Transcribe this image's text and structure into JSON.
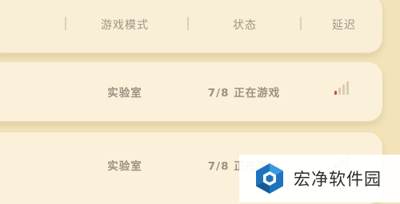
{
  "header": {
    "mode_label": "游戏模式",
    "status_label": "状态",
    "latency_label": "延迟"
  },
  "rows": [
    {
      "mode": "实验室",
      "status": "7/8 正在游戏",
      "signal_bars_active": 1,
      "signal_total_bars": 4,
      "signal_active_color": "#c8523e",
      "signal_inactive_color": "#d7cdb7"
    },
    {
      "mode": "实验室",
      "status": "7/8 正在游戏",
      "signal_bars_active": 1,
      "signal_total_bars": 4,
      "signal_active_color": "#c8523e",
      "signal_inactive_color": "#d7cdb7"
    }
  ],
  "watermark": {
    "text": "宏净软件园",
    "icon": "hongjing-logo-icon"
  },
  "colors": {
    "background": "#f2e3b9",
    "panel": "#fbf0d9",
    "text": "#9e9686"
  }
}
